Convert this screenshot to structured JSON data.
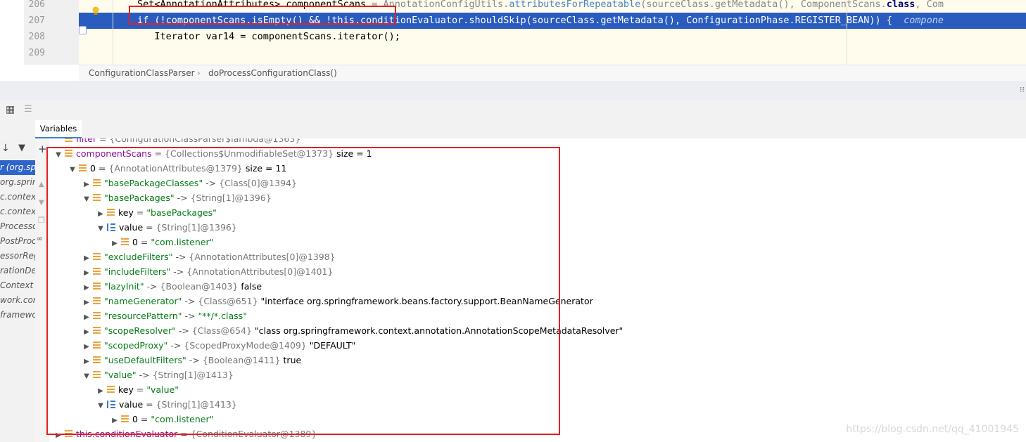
{
  "editor": {
    "lines": [
      {
        "no": "206",
        "segments": [
          {
            "t": "Set<AnnotationAttributes> componentScans",
            "c": ""
          },
          {
            "t": " = AnnotationConfigUtils.",
            "c": "g"
          },
          {
            "t": "attributesForRepeatable",
            "c": "mc"
          },
          {
            "t": "(sourceClass.getMetadata(), ComponentScans.",
            "c": "g"
          },
          {
            "t": "class",
            "c": "kw"
          },
          {
            "t": ", Com",
            "c": "g"
          }
        ]
      },
      {
        "no": "207",
        "segments": [
          {
            "t": "if (!componentScans.isEmpty() && !this.conditionEvaluator.shouldSkip(sourceClass.getMetadata(), ConfigurationPhase.REGISTER_BEAN)) {  ",
            "c": ""
          },
          {
            "t": "compone",
            "c": "hint"
          }
        ]
      },
      {
        "no": "208",
        "segments": [
          {
            "t": "   Iterator var14 = componentScans.iterator();",
            "c": ""
          }
        ]
      },
      {
        "no": "209",
        "segments": []
      }
    ],
    "breadcrumb": [
      "ConfigurationClassParser",
      "doProcessConfigurationClass()"
    ]
  },
  "panel": {
    "tab_label": "Variables",
    "frames": [
      "r (org.spr",
      "org.sprin",
      "c.context.",
      "c.context.",
      "Processo",
      "PostProc",
      "essorReg",
      "rationDe",
      "Context",
      "work.cont",
      "framewo"
    ],
    "selected_frame": 0
  },
  "variables": [
    {
      "d": 0,
      "arrow": "",
      "icon": "field",
      "name": "filter",
      "sep": " = ",
      "type": "{ConfigurationClassParser$lambda@1363}",
      "val": ""
    },
    {
      "d": 0,
      "arrow": "▼",
      "icon": "field",
      "name": "componentScans",
      "sep": " = ",
      "type": "{Collections$UnmodifiableSet@1373}",
      "val": " size = 1"
    },
    {
      "d": 1,
      "arrow": "▼",
      "icon": "field",
      "key": "0",
      "sep": " = ",
      "type": "{AnnotationAttributes@1379}",
      "val": " size = 11"
    },
    {
      "d": 2,
      "arrow": "▶",
      "icon": "field",
      "str": "\"basePackageClasses\"",
      "sep": " -> ",
      "type": "{Class[0]@1394}",
      "val": ""
    },
    {
      "d": 2,
      "arrow": "▼",
      "icon": "field",
      "str": "\"basePackages\"",
      "sep": " -> ",
      "type": "{String[1]@1396}",
      "val": ""
    },
    {
      "d": 3,
      "arrow": "▶",
      "icon": "field",
      "key": "key",
      "sep": " = ",
      "str2": "\"basePackages\"",
      "type": "",
      "val": ""
    },
    {
      "d": 3,
      "arrow": "▼",
      "icon": "arr",
      "key": "value",
      "sep": " = ",
      "type": "{String[1]@1396}",
      "val": ""
    },
    {
      "d": 4,
      "arrow": "▶",
      "icon": "field",
      "key": "0",
      "sep": " = ",
      "str2": "\"com.listener\"",
      "type": "",
      "val": ""
    },
    {
      "d": 2,
      "arrow": "▶",
      "icon": "field",
      "str": "\"excludeFilters\"",
      "sep": " -> ",
      "type": "{AnnotationAttributes[0]@1398}",
      "val": ""
    },
    {
      "d": 2,
      "arrow": "▶",
      "icon": "field",
      "str": "\"includeFilters\"",
      "sep": " -> ",
      "type": "{AnnotationAttributes[0]@1401}",
      "val": ""
    },
    {
      "d": 2,
      "arrow": "▶",
      "icon": "field",
      "str": "\"lazyInit\"",
      "sep": " -> ",
      "type": "{Boolean@1403}",
      "val": " false"
    },
    {
      "d": 2,
      "arrow": "▶",
      "icon": "field",
      "str": "\"nameGenerator\"",
      "sep": " -> ",
      "type": "{Class@651}",
      "val": " \"interface org.springframework.beans.factory.support.BeanNameGenerator"
    },
    {
      "d": 2,
      "arrow": "▶",
      "icon": "field",
      "str": "\"resourcePattern\"",
      "sep": " -> ",
      "type": "",
      "str2": "\"**/*.class\"",
      "val": ""
    },
    {
      "d": 2,
      "arrow": "▶",
      "icon": "field",
      "str": "\"scopeResolver\"",
      "sep": " -> ",
      "type": "{Class@654}",
      "val": " \"class org.springframework.context.annotation.AnnotationScopeMetadataResolver\""
    },
    {
      "d": 2,
      "arrow": "▶",
      "icon": "field",
      "str": "\"scopedProxy\"",
      "sep": " -> ",
      "type": "{ScopedProxyMode@1409}",
      "val": " \"DEFAULT\""
    },
    {
      "d": 2,
      "arrow": "▶",
      "icon": "field",
      "str": "\"useDefaultFilters\"",
      "sep": " -> ",
      "type": "{Boolean@1411}",
      "val": " true"
    },
    {
      "d": 2,
      "arrow": "▼",
      "icon": "field",
      "str": "\"value\"",
      "sep": " -> ",
      "type": "{String[1]@1413}",
      "val": ""
    },
    {
      "d": 3,
      "arrow": "▶",
      "icon": "field",
      "key": "key",
      "sep": " = ",
      "str2": "\"value\"",
      "type": "",
      "val": ""
    },
    {
      "d": 3,
      "arrow": "▼",
      "icon": "arr",
      "key": "value",
      "sep": " = ",
      "type": "{String[1]@1413}",
      "val": ""
    },
    {
      "d": 4,
      "arrow": "▶",
      "icon": "field",
      "key": "0",
      "sep": " = ",
      "str2": "\"com.listener\"",
      "type": "",
      "val": ""
    },
    {
      "d": 0,
      "arrow": "▶",
      "icon": "field",
      "name": "this.conditionEvaluator",
      "sep": " = ",
      "type": "{ConditionEvaluator@1389}",
      "val": ""
    }
  ],
  "watermark": "https://blog.csdn.net/qq_41001945"
}
